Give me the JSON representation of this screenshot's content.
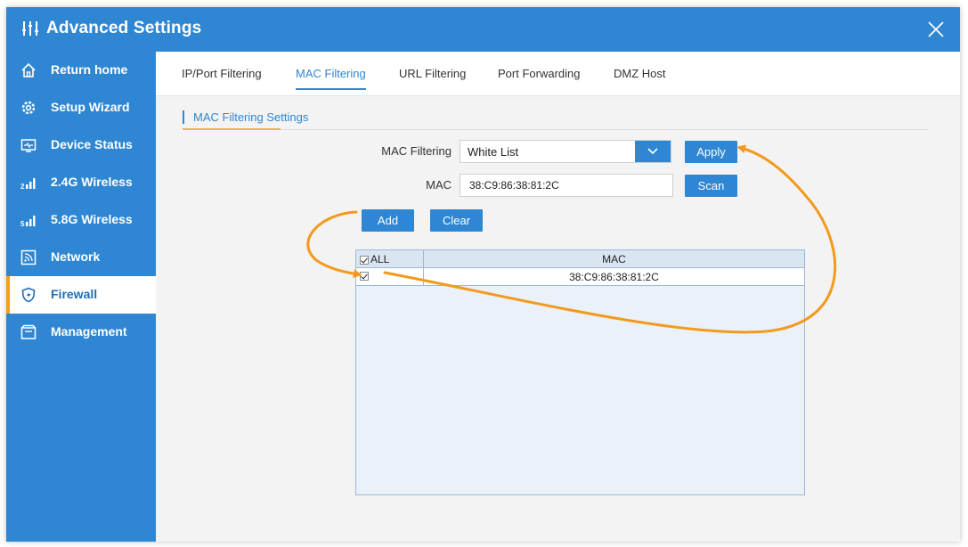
{
  "window": {
    "title": "Advanced Settings"
  },
  "sidebar": {
    "items": [
      {
        "label": "Return home",
        "icon": "home-icon"
      },
      {
        "label": "Setup Wizard",
        "icon": "gear-icon"
      },
      {
        "label": "Device Status",
        "icon": "monitor-icon"
      },
      {
        "label": "2.4G Wireless",
        "icon": "signal-2g-icon"
      },
      {
        "label": "5.8G Wireless",
        "icon": "signal-5g-icon"
      },
      {
        "label": "Network",
        "icon": "network-icon"
      },
      {
        "label": "Firewall",
        "icon": "firewall-icon",
        "active": true
      },
      {
        "label": "Management",
        "icon": "management-icon"
      }
    ]
  },
  "tabs": [
    {
      "label": "IP/Port Filtering"
    },
    {
      "label": "MAC Filtering",
      "active": true
    },
    {
      "label": "URL Filtering"
    },
    {
      "label": "Port Forwarding"
    },
    {
      "label": "DMZ Host"
    }
  ],
  "section": {
    "title": "MAC Filtering Settings"
  },
  "form": {
    "mac_filtering_label": "MAC Filtering",
    "mac_filtering_value": "White List",
    "apply_label": "Apply",
    "mac_label": "MAC",
    "mac_value": "38:C9:86:38:81:2C",
    "scan_label": "Scan",
    "add_label": "Add",
    "clear_label": "Clear"
  },
  "table": {
    "headers": [
      "ALL",
      "MAC"
    ],
    "rows": [
      {
        "checked": true,
        "mac": "38:C9:86:38:81:2C"
      }
    ],
    "all_checked": true
  },
  "colors": {
    "primary": "#2f86d2",
    "accent": "#f5a01a",
    "annotation": "#f39a1e"
  }
}
